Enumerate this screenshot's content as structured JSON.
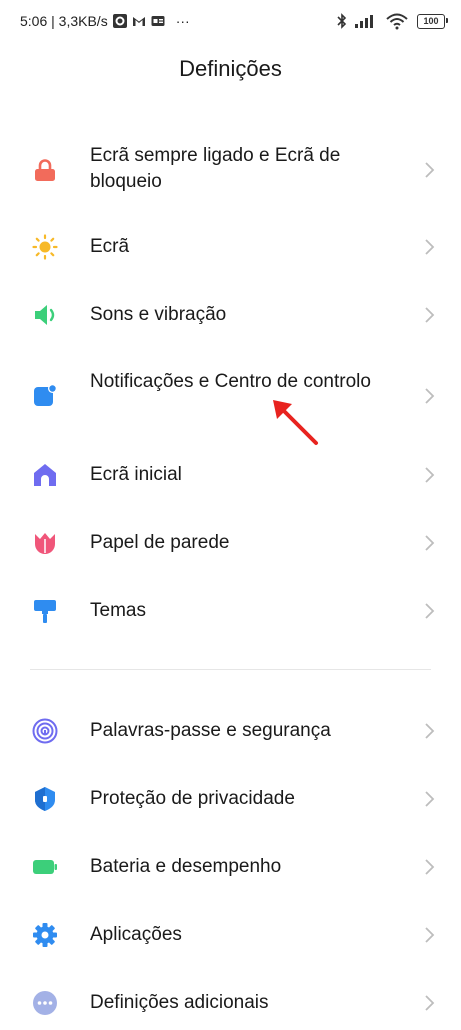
{
  "status_bar": {
    "time_speed": "5:06 | 3,3KB/s",
    "dots": "···",
    "battery": "100"
  },
  "page_title": "Definições",
  "section1": [
    {
      "label": "Ecrã sempre ligado e Ecrã de bloqueio",
      "icon": "lock-icon",
      "color": "#f26b5b"
    },
    {
      "label": "Ecrã",
      "icon": "sun-icon",
      "color": "#f7b928"
    },
    {
      "label": "Sons e vibração",
      "icon": "speaker-icon",
      "color": "#3ccf7a"
    },
    {
      "label": "Notificações e Centro de controlo",
      "icon": "notification-icon",
      "color": "#2f8cf0"
    },
    {
      "label": "Ecrã inicial",
      "icon": "home-icon",
      "color": "#6f6cf0"
    },
    {
      "label": "Papel de parede",
      "icon": "tulip-icon",
      "color": "#f0567a"
    },
    {
      "label": "Temas",
      "icon": "paint-roller-icon",
      "color": "#2f8cf0"
    }
  ],
  "section2": [
    {
      "label": "Palavras-passe e segurança",
      "icon": "fingerprint-icon",
      "color": "#6f6cf0"
    },
    {
      "label": "Proteção de privacidade",
      "icon": "shield-icon",
      "color": "#2f8cf0"
    },
    {
      "label": "Bateria e desempenho",
      "icon": "battery-icon",
      "color": "#3ccf7a"
    },
    {
      "label": "Aplicações",
      "icon": "gear-icon",
      "color": "#2f8cf0"
    },
    {
      "label": "Definições adicionais",
      "icon": "more-icon",
      "color": "#8c9bd6"
    }
  ],
  "annotation": {
    "color": "#e8231f"
  }
}
